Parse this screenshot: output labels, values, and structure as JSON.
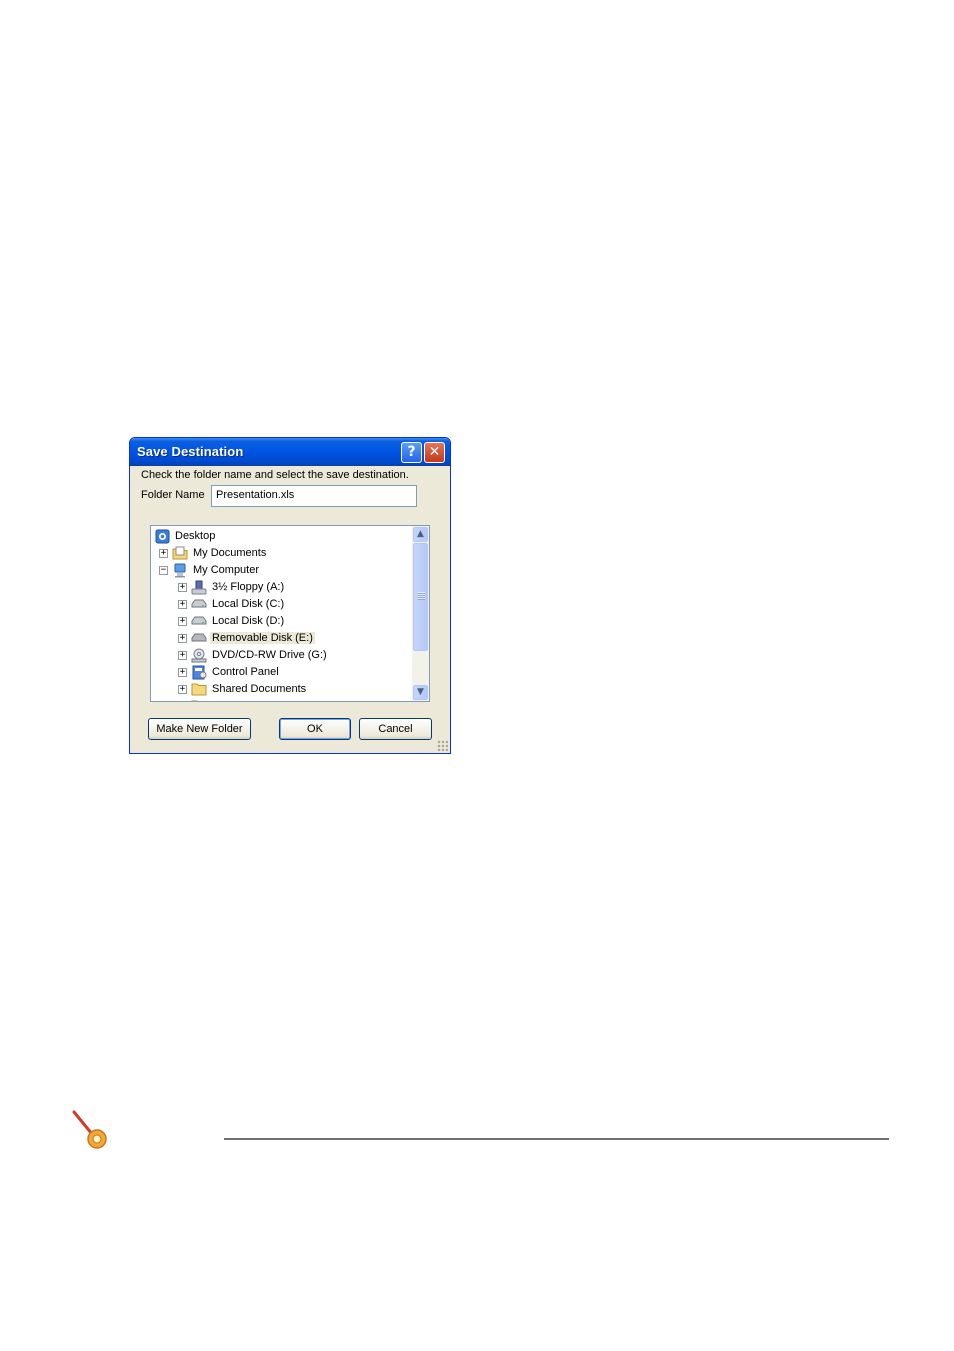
{
  "dialog": {
    "title": "Save Destination",
    "help_label": "?",
    "close_label": "✕",
    "instruction": "Check the folder name and select the save destination.",
    "folder_name_label": "Folder Name",
    "folder_name_value": "Presentation.xls",
    "tree": [
      {
        "label": "Desktop",
        "icon": "desktop-icon",
        "expander": ""
      },
      {
        "label": "My Documents",
        "icon": "my-documents-icon",
        "expander": "+"
      },
      {
        "label": "My Computer",
        "icon": "my-computer-icon",
        "expander": "−"
      },
      {
        "label": "3½ Floppy (A:)",
        "icon": "floppy-icon",
        "expander": "+"
      },
      {
        "label": "Local Disk (C:)",
        "icon": "hard-disk-icon",
        "expander": "+"
      },
      {
        "label": "Local Disk (D:)",
        "icon": "hard-disk-icon",
        "expander": "+"
      },
      {
        "label": "Removable Disk (E:)",
        "icon": "removable-disk-icon",
        "expander": "+",
        "selected": true
      },
      {
        "label": "DVD/CD-RW Drive (G:)",
        "icon": "dvd-drive-icon",
        "expander": "+"
      },
      {
        "label": "Control Panel",
        "icon": "control-panel-icon",
        "expander": "+"
      },
      {
        "label": "Shared Documents",
        "icon": "folder-icon",
        "expander": "+"
      }
    ],
    "buttons": {
      "make_new_folder": "Make New Folder",
      "ok": "OK",
      "cancel": "Cancel"
    }
  },
  "colors": {
    "titlebar": "#0054e3",
    "dialog_bg": "#ece9d8",
    "note_icon": "#f0a030"
  }
}
